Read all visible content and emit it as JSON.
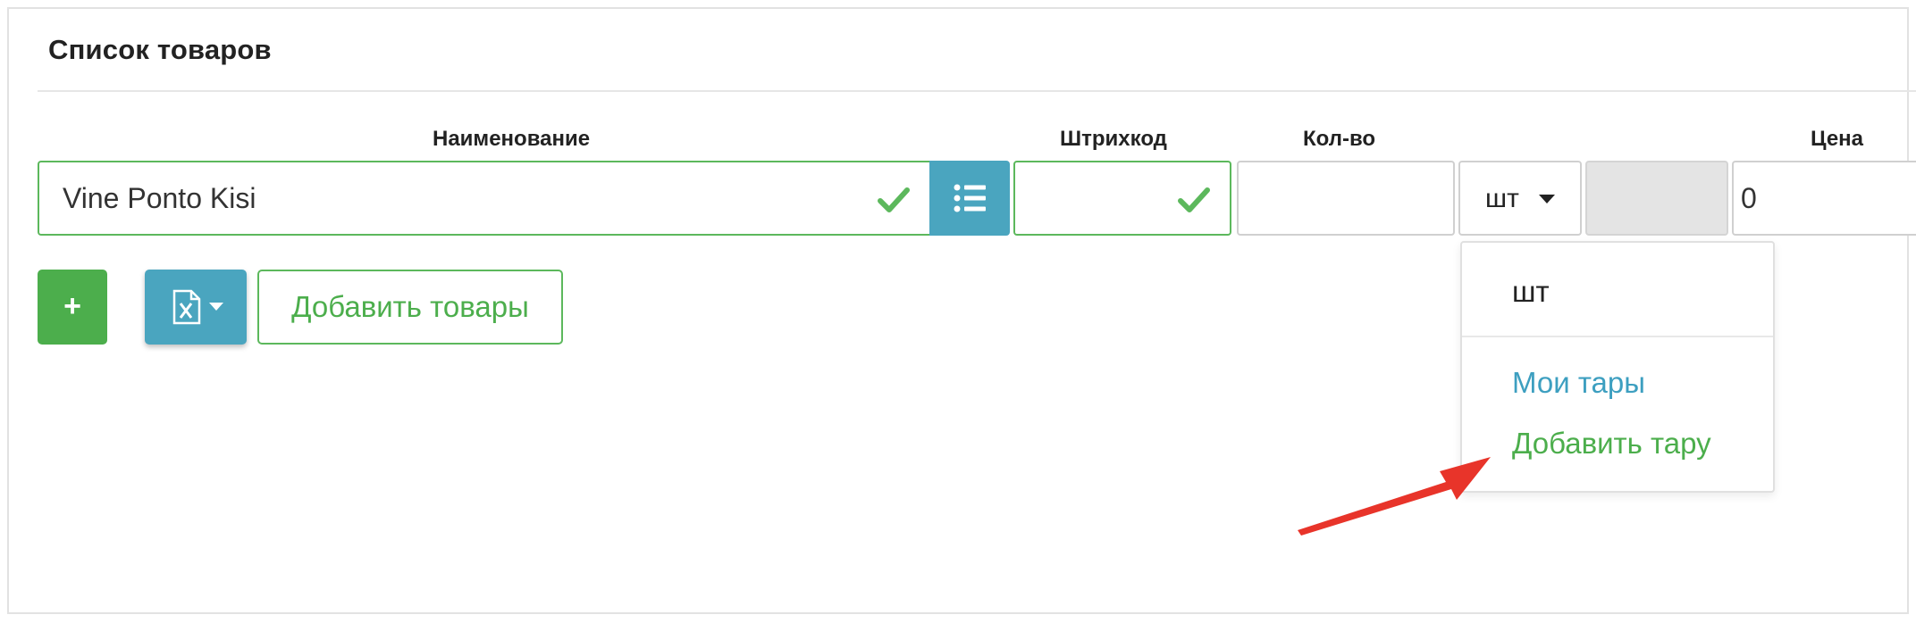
{
  "panel": {
    "title": "Список товаров"
  },
  "columns": {
    "name": "Наименование",
    "barcode": "Штрихкод",
    "qty": "Кол-во",
    "price": "Цена"
  },
  "row": {
    "name_value": "Vine Ponto Kisi",
    "barcode_value": "",
    "qty_value": "",
    "unit_selected": "шт",
    "price_value": "0"
  },
  "actions": {
    "add_label": "+",
    "add_goods_label": "Добавить товары"
  },
  "unit_dropdown": {
    "items": [
      "шт"
    ],
    "my_tare_label": "Мои тары",
    "add_tare_label": "Добавить тару"
  },
  "icons": {
    "valid": "check-icon",
    "list": "list-icon",
    "excel": "excel-icon",
    "caret": "caret-down-icon",
    "annotation": "red-arrow-icon"
  },
  "colors": {
    "success": "#5cb85c",
    "info": "#4aa5bf",
    "link": "#3d9fc0",
    "annotation_arrow": "#e8342a"
  }
}
